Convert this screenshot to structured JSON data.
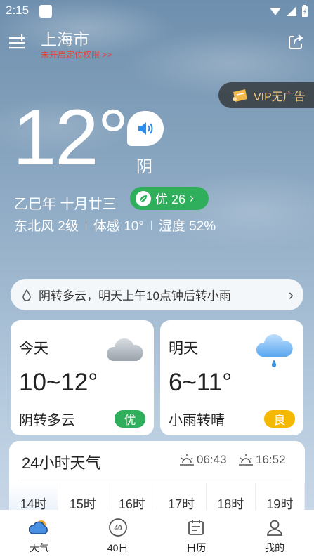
{
  "status_bar": {
    "time": "2:15"
  },
  "header": {
    "city": "上海市",
    "locate_tip": "未开启定位权限 >>",
    "vip_label": "VIP无广告"
  },
  "current": {
    "temperature": "12°",
    "condition": "阴",
    "lunar_date": "乙巳年 十月廿三",
    "aqi_label": "优 26",
    "wind": "东北风 2级",
    "feels_like": "体感 10°",
    "humidity": "湿度 52%"
  },
  "banner": {
    "text": "阴转多云，明天上午10点钟后转小雨"
  },
  "days": [
    {
      "day": "今天",
      "range": "10~12°",
      "desc": "阴转多云",
      "aqi": "优",
      "aqi_color": "#2fae5b",
      "icon": "cloud-icon"
    },
    {
      "day": "明天",
      "range": "6~11°",
      "desc": "小雨转晴",
      "aqi": "良",
      "aqi_color": "#f5b800",
      "icon": "rain-cloud-icon"
    }
  ],
  "hourly": {
    "title": "24小时天气",
    "sunrise": "06:43",
    "sunset": "16:52",
    "hours": [
      "14时",
      "15时",
      "16时",
      "17时",
      "18时",
      "19时"
    ]
  },
  "nav": {
    "items": [
      {
        "label": "天气",
        "icon": "weather-icon"
      },
      {
        "label": "40日",
        "icon": "forty-day-icon"
      },
      {
        "label": "日历",
        "icon": "calendar-icon"
      },
      {
        "label": "我的",
        "icon": "user-icon"
      }
    ]
  },
  "colors": {
    "aqi_good": "#2fae5b",
    "aqi_moderate": "#f5b800",
    "vip_text": "#f5c97a",
    "locate_tip": "#e8423a"
  }
}
